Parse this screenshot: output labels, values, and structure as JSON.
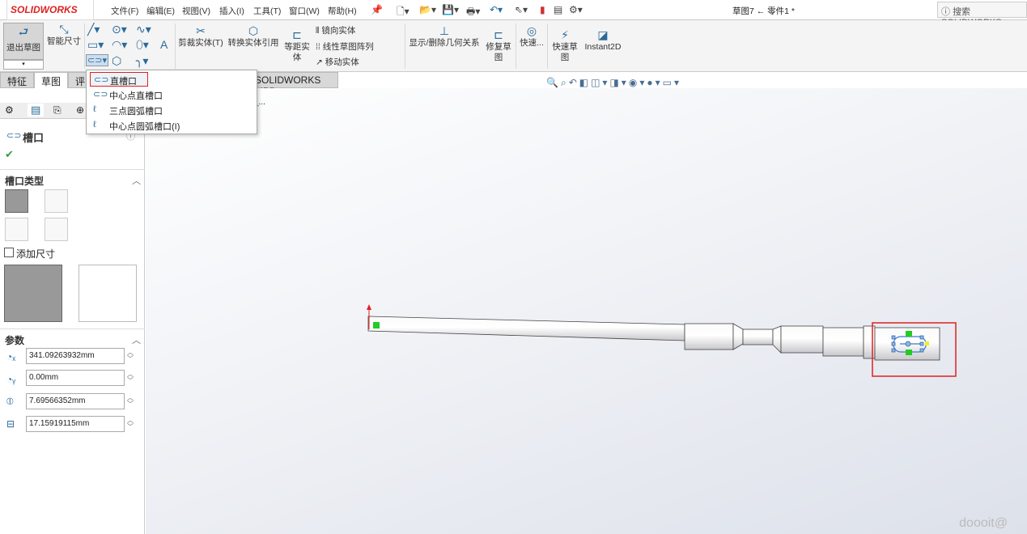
{
  "app": {
    "logo": "SOLIDWORKS",
    "title": "草图7 ← 零件1 *",
    "search": "搜索 SOLIDWORKS",
    "help_icon": "help-icon"
  },
  "menu": [
    "文件(F)",
    "编辑(E)",
    "视图(V)",
    "插入(I)",
    "工具(T)",
    "窗口(W)",
    "帮助(H)"
  ],
  "ribbon": {
    "exit_sketch": "退出草图",
    "smart_dim": "智能尺寸",
    "trim": "剪裁实体(T)",
    "convert": "转换实体引用",
    "offset": "等距实体",
    "mirror": "镜向实体",
    "linear_pattern": "线性草图阵列",
    "move": "移动实体",
    "relations": "显示/删除几何关系",
    "repair": "修复草图",
    "quick_snaps": "快速...",
    "rapid_sketch": "快速草图",
    "instant2d": "Instant2D"
  },
  "tabs": [
    "特征",
    "草图",
    "评",
    "SOLIDWORKS MBD"
  ],
  "slot_menu": {
    "items": [
      "直槽口",
      "中心点直槽口",
      "三点圆弧槽口",
      "中心点圆弧槽口(I)"
    ],
    "selected": 0
  },
  "panel": {
    "title": "槽口",
    "slot_type": "槽口类型",
    "add_dim": "添加尺寸",
    "add_dim_checked": false,
    "params": "参数",
    "values": [
      "341.09263932mm",
      "0.00mm",
      "7.69566352mm",
      "17.15919115mm"
    ]
  },
  "graphics": {
    "tree_stub": "_...",
    "watermark": "doooit@"
  },
  "colors": {
    "accent": "#2a6a9a",
    "highlight": "#e02020",
    "check": "#3a9a3a"
  }
}
